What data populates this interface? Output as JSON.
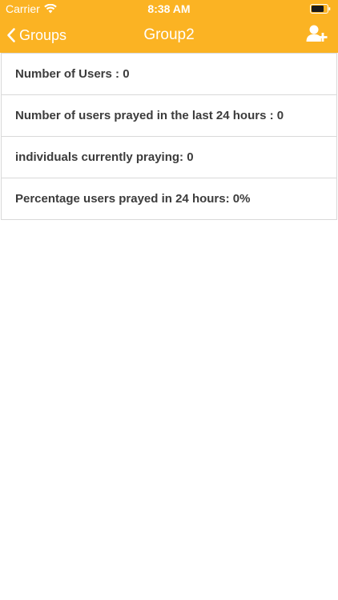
{
  "status_bar": {
    "carrier": "Carrier",
    "time": "8:38 AM",
    "wifi_icon": "wifi-icon",
    "battery_icon": "battery-icon"
  },
  "nav": {
    "back_label": "Groups",
    "title": "Group2",
    "add_user_icon": "add-user-icon",
    "bar_color": "#fbb323"
  },
  "stats": [
    {
      "label": "Number of Users : 0"
    },
    {
      "label": "Number of users prayed in the last 24 hours : 0"
    },
    {
      "label": "individuals currently praying: 0"
    },
    {
      "label": "Percentage users prayed in 24 hours: 0%"
    }
  ]
}
